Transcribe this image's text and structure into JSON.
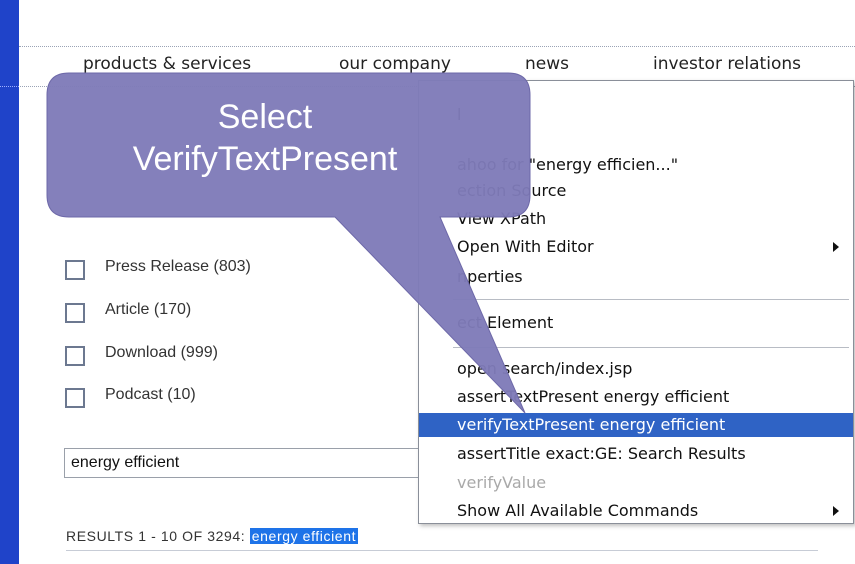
{
  "nav": {
    "items": [
      "products & services",
      "our company",
      "news",
      "investor relations"
    ]
  },
  "filters": [
    {
      "label": "Press Release (803)"
    },
    {
      "label": "Article (170)"
    },
    {
      "label": "Download (999)"
    },
    {
      "label": "Podcast (10)"
    }
  ],
  "search": {
    "value": "energy efficient"
  },
  "results": {
    "prefix": "RESULTS 1 - 10 OF 3294: ",
    "highlight": "energy efficient"
  },
  "context_menu": {
    "items": [
      {
        "label": "l"
      },
      {
        "label": "ahoo for \"energy efficien...\""
      },
      {
        "label": "ection Source"
      },
      {
        "label": "View XPath"
      },
      {
        "label": "Open With Editor"
      },
      {
        "label": "nperties"
      },
      {
        "label": "ect Element"
      },
      {
        "label": "open search/index.jsp"
      },
      {
        "label": "assertTextPresent energy efficient"
      },
      {
        "label": "verifyTextPresent energy efficient"
      },
      {
        "label": "assertTitle exact:GE: Search Results"
      },
      {
        "label": "verifyValue"
      },
      {
        "label": "Show All Available Commands"
      }
    ]
  },
  "callout": {
    "line1": "Select",
    "line2": "VerifyTextPresent",
    "color": "#7f7bb8"
  },
  "colors": {
    "background_blue": "#1f43c9",
    "selection": "#2f63c5",
    "highlight": "#1e73e8"
  }
}
